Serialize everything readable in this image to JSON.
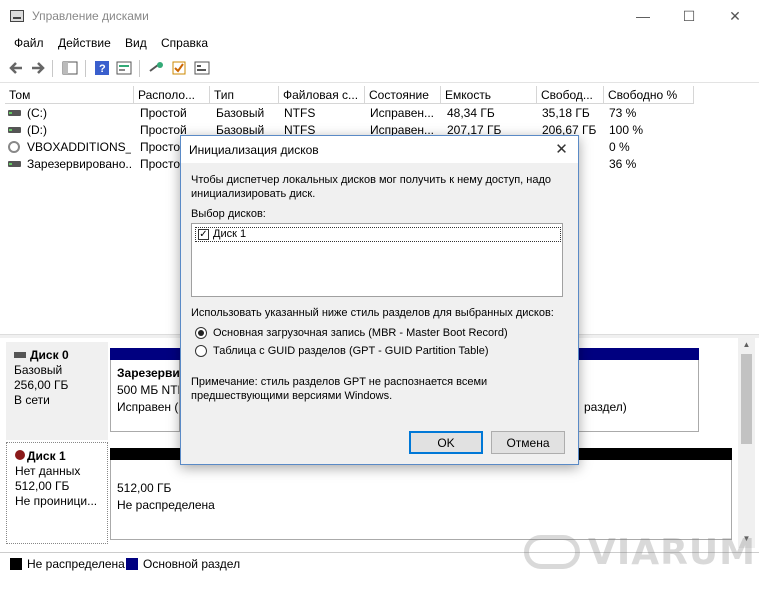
{
  "window": {
    "title": "Управление дисками",
    "minimize_glyph": "—",
    "maximize_glyph": "☐",
    "close_glyph": "✕"
  },
  "menu": [
    "Файл",
    "Действие",
    "Вид",
    "Справка"
  ],
  "toolbar": {
    "icons": [
      "back-arrow-icon",
      "forward-arrow-icon",
      "console-tree-icon",
      "help-icon",
      "properties-icon",
      "connect-icon",
      "check-icon",
      "settings-icon"
    ]
  },
  "volume_table": {
    "columns": [
      "Том",
      "Располо...",
      "Тип",
      "Файловая с...",
      "Состояние",
      "Емкость",
      "Свобод...",
      "Свободно %"
    ],
    "rows": [
      {
        "tom": "(C:)",
        "layout": "Простой",
        "type": "Базовый",
        "fs": "NTFS",
        "status": "Исправен...",
        "capacity": "48,34 ГБ",
        "free": "35,18 ГБ",
        "free_pct": "73 %",
        "icon": "drive-icon"
      },
      {
        "tom": "(D:)",
        "layout": "Простой",
        "type": "Базовый",
        "fs": "NTFS",
        "status": "Исправен...",
        "capacity": "207,17 ГБ",
        "free": "206,67 ГБ",
        "free_pct": "100 %",
        "icon": "drive-icon"
      },
      {
        "tom": "VBOXADDITIONS_...",
        "layout": "Простой",
        "type": "",
        "fs": "",
        "status": "",
        "capacity": "",
        "free": "",
        "free_pct": "0 %",
        "icon": "cd-icon"
      },
      {
        "tom": "Зарезервировано...",
        "layout": "Простой",
        "type": "",
        "fs": "",
        "status": "",
        "capacity": "",
        "free": "",
        "free_pct": "36 %",
        "icon": "drive-icon"
      }
    ]
  },
  "disks": [
    {
      "name": "Диск 0",
      "type": "Базовый",
      "size": "256,00 ГБ",
      "status": "В сети",
      "partition": {
        "name": "Зарезерви",
        "size": "500 МБ NTF",
        "status": "Исправен (",
        "right_text": "раздел)"
      }
    },
    {
      "name": "Диск 1",
      "type": "Нет данных",
      "size": "512,00 ГБ",
      "status": "Не проиници...",
      "partition": {
        "size": "512,00 ГБ",
        "status": "Не распределена"
      }
    }
  ],
  "legend": [
    {
      "label": "Не распределена",
      "color": "#000000"
    },
    {
      "label": "Основной раздел",
      "color": "#000080"
    }
  ],
  "watermark": "VIARUM",
  "dialog": {
    "title": "Инициализация дисков",
    "description": "Чтобы диспетчер локальных дисков мог получить к нему доступ, надо инициализировать диск.",
    "select_label": "Выбор дисков:",
    "disk_item": "Диск 1",
    "disk_checked": true,
    "style_label": "Использовать указанный ниже стиль разделов для выбранных дисков:",
    "options": [
      {
        "label": "Основная загрузочная запись (MBR - Master Boot Record)",
        "checked": true
      },
      {
        "label": "Таблица с GUID разделов (GPT - GUID Partition Table)",
        "checked": false
      }
    ],
    "note": "Примечание: стиль разделов GPT не распознается всеми предшествующими версиями Windows.",
    "ok_label": "OK",
    "cancel_label": "Отмена"
  }
}
